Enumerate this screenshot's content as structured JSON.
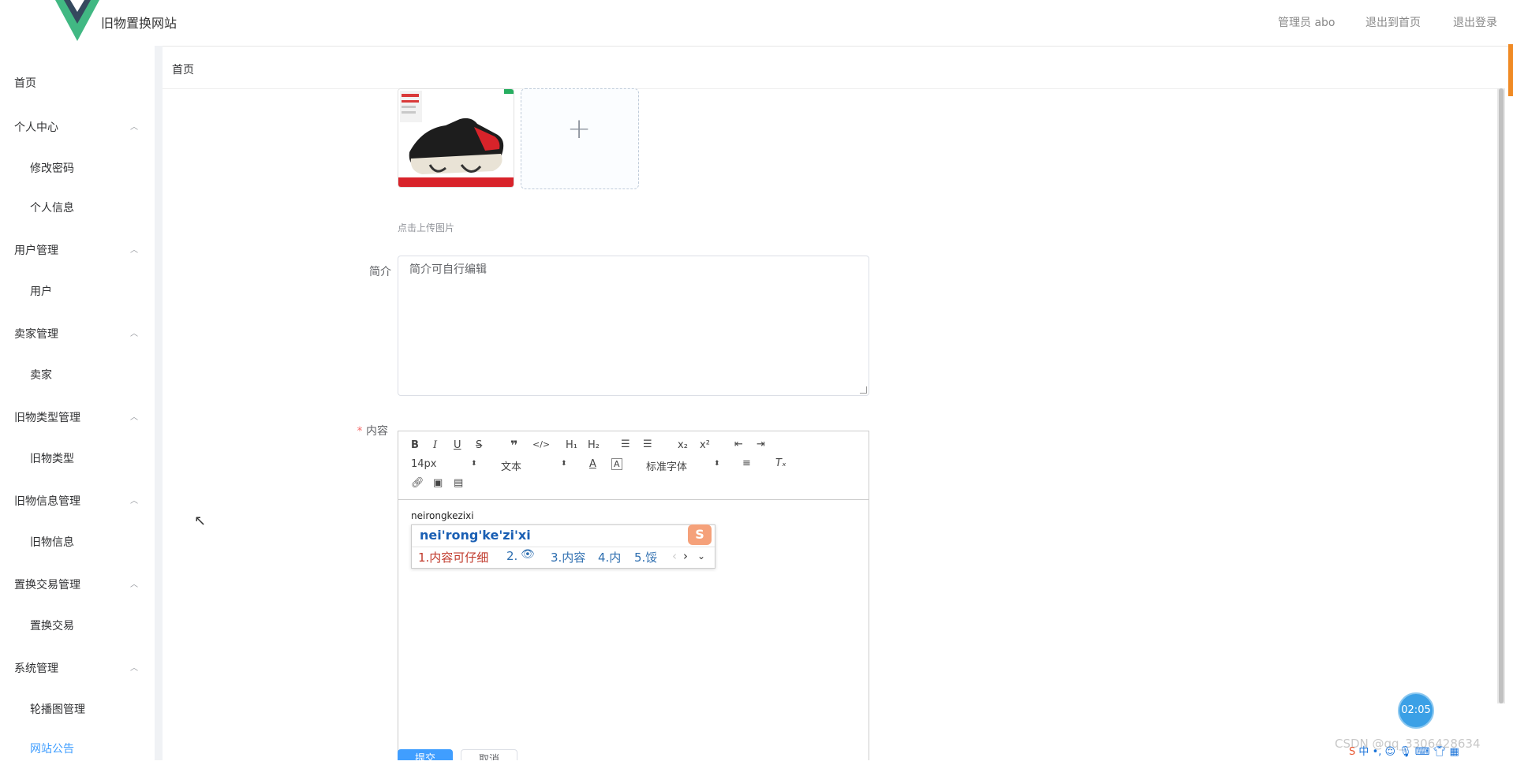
{
  "header": {
    "site_title": "旧物置换网站",
    "admin_label": "管理员 abo",
    "back_home": "退出到首页",
    "logout": "退出登录"
  },
  "sidebar": {
    "home": "首页",
    "groups": [
      {
        "label": "个人中心",
        "children": [
          "修改密码",
          "个人信息"
        ]
      },
      {
        "label": "用户管理",
        "children": [
          "用户"
        ]
      },
      {
        "label": "卖家管理",
        "children": [
          "卖家"
        ]
      },
      {
        "label": "旧物类型管理",
        "children": [
          "旧物类型"
        ]
      },
      {
        "label": "旧物信息管理",
        "children": [
          "旧物信息"
        ]
      },
      {
        "label": "置换交易管理",
        "children": [
          "置换交易"
        ]
      },
      {
        "label": "系统管理",
        "children": [
          "轮播图管理",
          "网站公告"
        ]
      }
    ]
  },
  "breadcrumb": "首页",
  "form": {
    "upload_tip": "点击上传图片",
    "intro_label": "简介",
    "intro_value": "简介可自行编辑",
    "content_label": "内容",
    "required_mark": "*",
    "save_label": "提交",
    "cancel_label": "取消"
  },
  "editor": {
    "font_size": "14px",
    "paragraph": "文本",
    "font_family": "标准字体",
    "typed_text": "neirongkezixi",
    "ime": {
      "pinyin": "nei'rong'ke'zi'xi",
      "candidates": [
        "1.内容可仔细",
        "2.",
        "3.内容",
        "4.内",
        "5.馁"
      ]
    }
  },
  "overlay": {
    "timer": "02:05",
    "watermark": "CSDN @qq_3306428634"
  }
}
